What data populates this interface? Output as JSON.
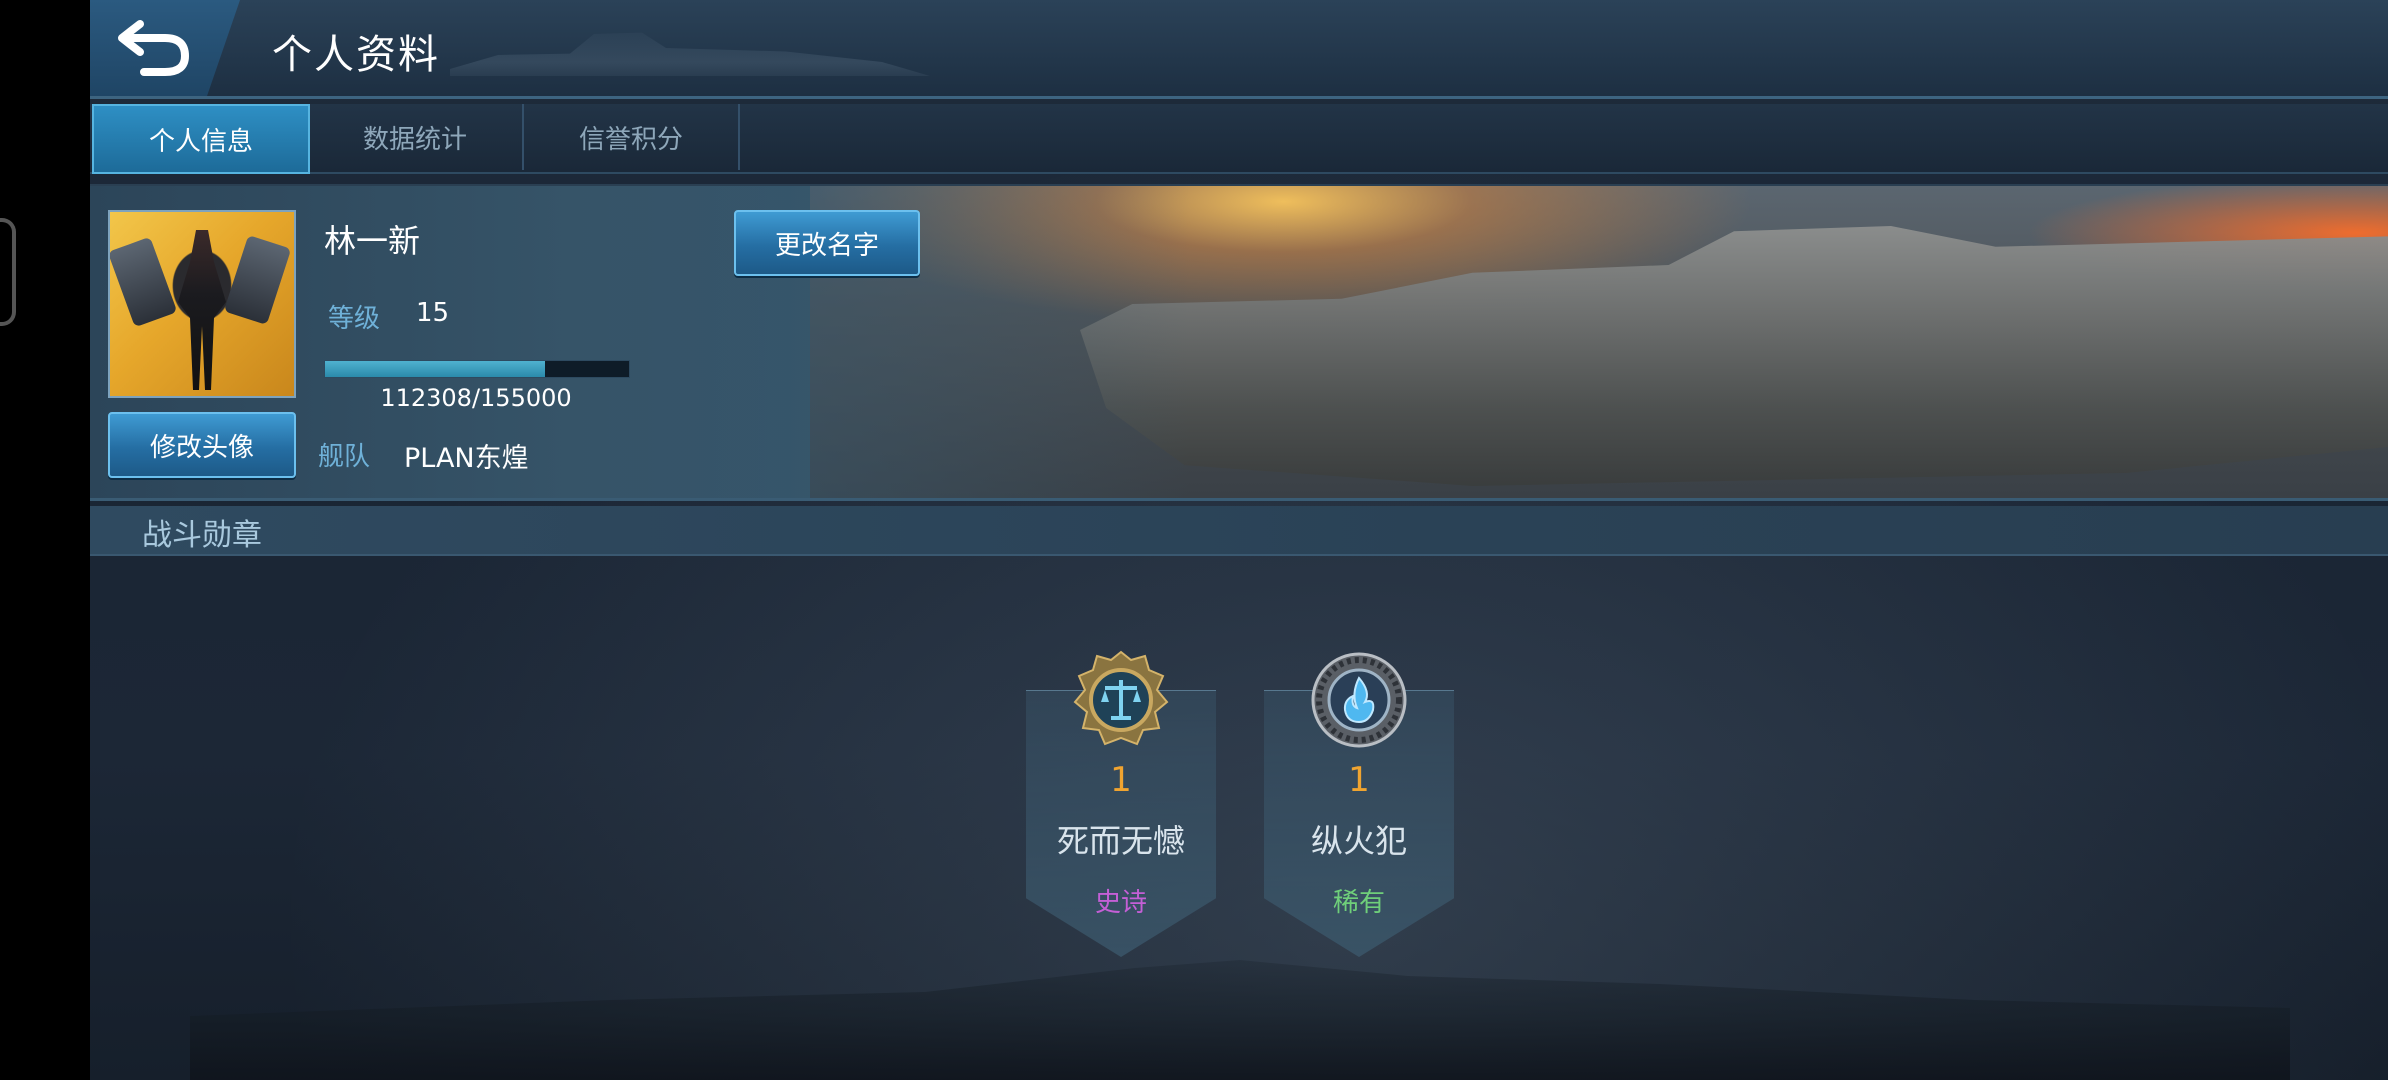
{
  "header": {
    "title": "个人资料",
    "back_icon": "back-arrow-icon"
  },
  "tabs": [
    {
      "label": "个人信息",
      "active": true
    },
    {
      "label": "数据统计",
      "active": false
    },
    {
      "label": "信誉积分",
      "active": false
    }
  ],
  "profile": {
    "name": "林一新",
    "rename_button": "更改名字",
    "change_avatar_button": "修改头像",
    "level_label": "等级",
    "level_value": "15",
    "xp_text": "112308/155000",
    "xp_current": 112308,
    "xp_max": 155000,
    "fleet_label": "舰队",
    "fleet_value": "PLAN东煌"
  },
  "medals": {
    "section_title": "战斗勋章",
    "items": [
      {
        "count": "1",
        "name": "死而无憾",
        "rarity": "史诗",
        "rarity_color": "#c45fd6",
        "icon": "scales-medal-icon"
      },
      {
        "count": "1",
        "name": "纵火犯",
        "rarity": "稀有",
        "rarity_color": "#6fcf7a",
        "icon": "flame-medal-icon"
      }
    ]
  },
  "colors": {
    "accent": "#2e8fc4",
    "count_color": "#f0a430"
  }
}
